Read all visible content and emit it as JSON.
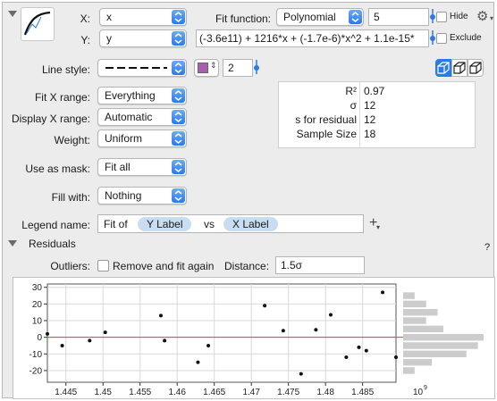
{
  "header": {
    "x_label": "X:",
    "x_value": "x",
    "y_label": "Y:",
    "y_value": "y",
    "fit_function_label": "Fit function:",
    "fit_function_value": "Polynomial",
    "degree": "5",
    "hide_label": "Hide",
    "hide_checked": false,
    "equation": "(-3.6e11) + 1216*x + (-1.7e-6)*x^2 + 1.1e-15*",
    "exclude_label": "Exclude",
    "exclude_checked": false
  },
  "style": {
    "line_style_label": "Line style:",
    "line_width": "2",
    "swatch_color": "#a85fb0"
  },
  "options": {
    "fit_x_range_label": "Fit X range:",
    "fit_x_range_value": "Everything",
    "display_x_range_label": "Display X range:",
    "display_x_range_value": "Automatic",
    "weight_label": "Weight:",
    "weight_value": "Uniform",
    "use_as_mask_label": "Use as mask:",
    "use_as_mask_value": "Fit all",
    "fill_with_label": "Fill with:",
    "fill_with_value": "Nothing"
  },
  "stats": [
    {
      "key": "R²",
      "value": "0.97"
    },
    {
      "key": "σ",
      "value": "12"
    },
    {
      "key": "s for residual",
      "value": "12"
    },
    {
      "key": "Sample Size",
      "value": "18"
    }
  ],
  "legend": {
    "label": "Legend name:",
    "prefix": "Fit of",
    "y_tag": "Y Label",
    "vs": "vs",
    "x_tag": "X Label"
  },
  "residuals": {
    "title": "Residuals",
    "help": "?",
    "outliers_label": "Outliers:",
    "remove_label": "Remove and fit again",
    "remove_checked": false,
    "distance_label": "Distance:",
    "distance_value": "1.5σ"
  },
  "colors": {
    "accent": "#2a7ae8",
    "zero_line": "#e0402a",
    "histogram": "#cccccc"
  },
  "chart_data": {
    "type": "scatter",
    "title": "",
    "xlabel": "",
    "ylabel": "",
    "xlim": [
      1.4425,
      1.4895
    ],
    "ylim": [
      -27,
      32
    ],
    "x_ticks": [
      1.445,
      1.45,
      1.455,
      1.46,
      1.465,
      1.47,
      1.475,
      1.48,
      1.485
    ],
    "x_tick_labels": [
      "1.445",
      "1.45",
      "1.455",
      "1.46",
      "1.465",
      "1.47",
      "1.475",
      "1.48",
      "1.485"
    ],
    "y_ticks": [
      -20,
      -10,
      0,
      10,
      20,
      30
    ],
    "y_tick_labels": [
      "-20",
      "-10",
      "0",
      "10",
      "20",
      "30"
    ],
    "x_multiplier_base": "10",
    "x_multiplier_exp": "9",
    "grid": true,
    "zero_line": 0,
    "x": [
      1.4425,
      1.4445,
      1.4482,
      1.4503,
      1.4578,
      1.4583,
      1.4628,
      1.4642,
      1.4718,
      1.4743,
      1.4767,
      1.4787,
      1.4807,
      1.4828,
      1.4845,
      1.4855,
      1.4877,
      1.4895
    ],
    "y": [
      2,
      -5,
      -2,
      3,
      13,
      -2,
      -15,
      -5,
      19,
      4,
      -22,
      4.5,
      13.5,
      -12,
      -6,
      -8,
      27,
      -12
    ],
    "histogram_bins": [
      {
        "center": 25,
        "count": 2
      },
      {
        "center": 20,
        "count": 4
      },
      {
        "center": 15,
        "count": 6
      },
      {
        "center": 10,
        "count": 4
      },
      {
        "center": 5,
        "count": 7
      },
      {
        "center": 0,
        "count": 14
      },
      {
        "center": -5,
        "count": 13
      },
      {
        "center": -10,
        "count": 11
      },
      {
        "center": -15,
        "count": 5
      },
      {
        "center": -20,
        "count": 2
      }
    ]
  }
}
